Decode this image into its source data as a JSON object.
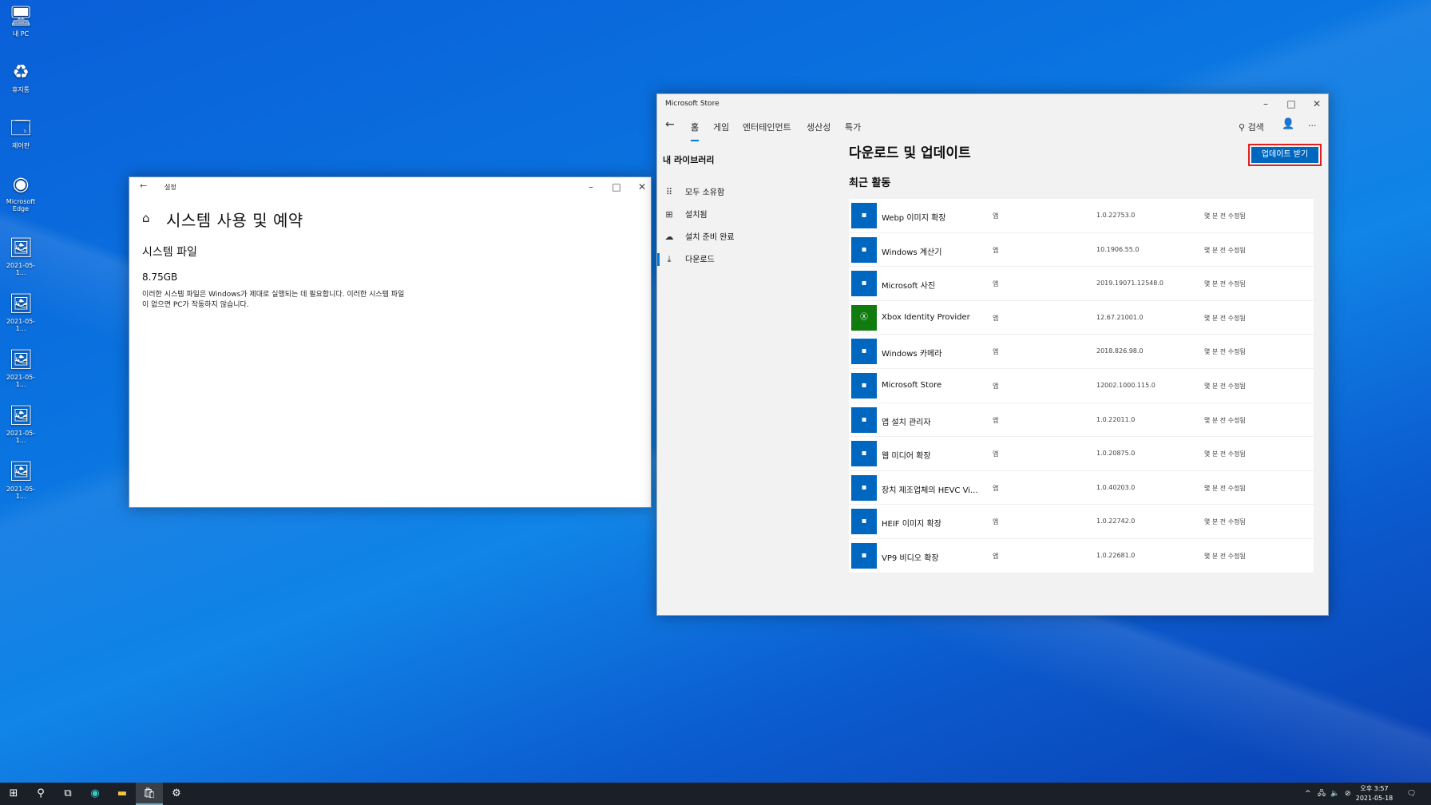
{
  "desktop": {
    "icons": [
      {
        "label": "내 PC",
        "icon": "computer-icon"
      },
      {
        "label": "휴지통",
        "icon": "recycle-bin-icon"
      },
      {
        "label": "제어판",
        "icon": "control-panel-icon"
      },
      {
        "label": "Microsoft Edge",
        "icon": "edge-icon"
      },
      {
        "label": "2021-05-1...",
        "icon": "image-file-icon"
      },
      {
        "label": "2021-05-1...",
        "icon": "image-file-icon"
      },
      {
        "label": "2021-05-1...",
        "icon": "image-file-icon"
      },
      {
        "label": "2021-05-1...",
        "icon": "image-file-icon"
      },
      {
        "label": "2021-05-1...",
        "icon": "image-file-icon"
      }
    ]
  },
  "settings": {
    "title": "설정",
    "page_title": "시스템 사용 및 예약",
    "section": "시스템 파일",
    "size": "8.75GB",
    "description": "이러한 시스템 파일은 Windows가 제대로 실행되는 데 필요합니다. 이러한 시스템 파일이 없으면 PC가 작동하지 않습니다."
  },
  "store": {
    "title": "Microsoft Store",
    "nav": [
      "홈",
      "게임",
      "엔터테인먼트",
      "생산성",
      "특가"
    ],
    "search_label": "검색",
    "sidebar_title": "내 라이브러리",
    "sidebar": [
      "모두 소유함",
      "설치됨",
      "설치 준비 완료",
      "다운로드"
    ],
    "heading": "다운로드 및 업데이트",
    "subheading": "최근 활동",
    "update_button": "업데이트 받기",
    "items": [
      {
        "name": "Webp 이미지 확장",
        "type": "앱",
        "version": "1.0.22753.0",
        "status": "몇 분 전 수정됨",
        "tile": "blue"
      },
      {
        "name": "Windows 계산기",
        "type": "앱",
        "version": "10.1906.55.0",
        "status": "몇 분 전 수정됨",
        "tile": "blue"
      },
      {
        "name": "Microsoft 사진",
        "type": "앱",
        "version": "2019.19071.12548.0",
        "status": "몇 분 전 수정됨",
        "tile": "blue"
      },
      {
        "name": "Xbox Identity Provider",
        "type": "앱",
        "version": "12.67.21001.0",
        "status": "몇 분 전 수정됨",
        "tile": "green"
      },
      {
        "name": "Windows 카메라",
        "type": "앱",
        "version": "2018.826.98.0",
        "status": "몇 분 전 수정됨",
        "tile": "blue"
      },
      {
        "name": "Microsoft Store",
        "type": "앱",
        "version": "12002.1000.115.0",
        "status": "몇 분 전 수정됨",
        "tile": "blue"
      },
      {
        "name": "앱 설치 관리자",
        "type": "앱",
        "version": "1.0.22011.0",
        "status": "몇 분 전 수정됨",
        "tile": "blue"
      },
      {
        "name": "웹 미디어 확장",
        "type": "앱",
        "version": "1.0.20875.0",
        "status": "몇 분 전 수정됨",
        "tile": "blue"
      },
      {
        "name": "장치 제조업체의 HEVC Vi...",
        "type": "앱",
        "version": "1.0.40203.0",
        "status": "몇 분 전 수정됨",
        "tile": "blue"
      },
      {
        "name": "HEIF 이미지 확장",
        "type": "앱",
        "version": "1.0.22742.0",
        "status": "몇 분 전 수정됨",
        "tile": "blue"
      },
      {
        "name": "VP9 비디오 확장",
        "type": "앱",
        "version": "1.0.22681.0",
        "status": "몇 분 전 수정됨",
        "tile": "blue"
      }
    ]
  },
  "taskbar": {
    "time": "오후 3:57",
    "date": "2021-05-18"
  }
}
